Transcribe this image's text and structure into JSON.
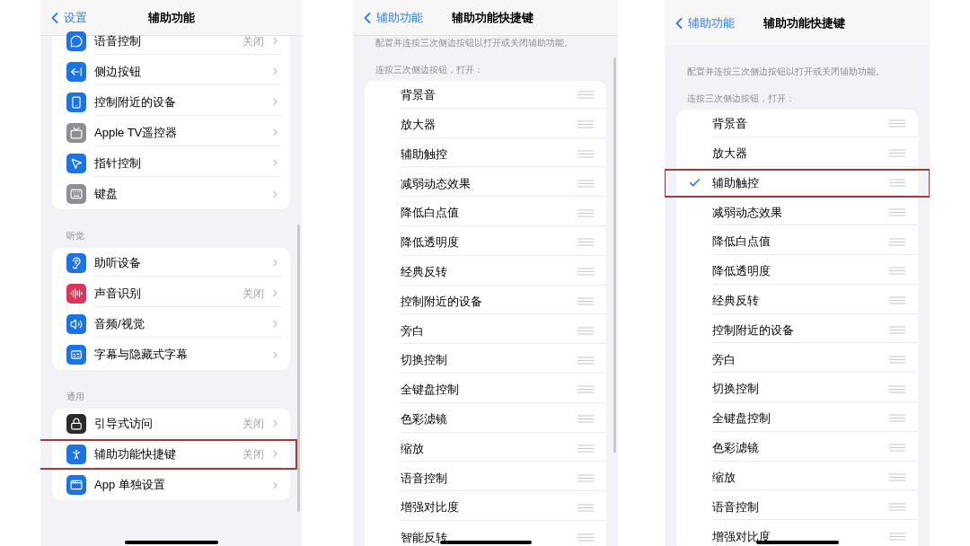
{
  "screens": [
    {
      "kind": "settings",
      "nav": {
        "back": "设置",
        "title": "辅助功能"
      },
      "sections": [
        {
          "rows": [
            {
              "label": "语音控制",
              "value": "关闭",
              "color": "#1a73e8",
              "highlighted": false
            },
            {
              "label": "侧边按钮",
              "color": "#1a73e8",
              "highlighted": false
            },
            {
              "label": "控制附近的设备",
              "color": "#1a73e8",
              "highlighted": false
            },
            {
              "label": "Apple TV遥控器",
              "color": "#8e8e93",
              "highlighted": false
            },
            {
              "label": "指针控制",
              "color": "#1a73e8",
              "highlighted": false
            },
            {
              "label": "键盘",
              "color": "#8e8e93",
              "highlighted": false
            }
          ]
        },
        {
          "header": "听觉",
          "rows": [
            {
              "label": "助听设备",
              "color": "#1a73e8",
              "highlighted": false
            },
            {
              "label": "声音识别",
              "value": "关闭",
              "color": "#e0325a",
              "highlighted": false
            },
            {
              "label": "音频/视觉",
              "color": "#1a73e8",
              "highlighted": false
            },
            {
              "label": "字幕与隐藏式字幕",
              "color": "#1a73e8",
              "highlighted": false
            }
          ]
        },
        {
          "header": "通用",
          "rows": [
            {
              "label": "引导式访问",
              "value": "关闭",
              "color": "#2c2c2e",
              "highlighted": false
            },
            {
              "label": "辅助功能快捷键",
              "value": "关闭",
              "color": "#1a73e8",
              "highlighted": true
            },
            {
              "label": "App 单独设置",
              "color": "#1a73e8",
              "highlighted": false
            }
          ]
        }
      ]
    },
    {
      "kind": "shortcut",
      "nav": {
        "back": "辅助功能",
        "title": "辅助功能快捷键"
      },
      "description": "配置并连按三次侧边按钮以打开或关闭辅助功能。",
      "subheader": "连按三次侧边按钮，打开：",
      "items": [
        {
          "label": "背景音",
          "checked": false,
          "highlighted": false
        },
        {
          "label": "放大器",
          "checked": false,
          "highlighted": false
        },
        {
          "label": "辅助触控",
          "checked": false,
          "highlighted": false
        },
        {
          "label": "减弱动态效果",
          "checked": false,
          "highlighted": false
        },
        {
          "label": "降低白点值",
          "checked": false,
          "highlighted": false
        },
        {
          "label": "降低透明度",
          "checked": false,
          "highlighted": false
        },
        {
          "label": "经典反转",
          "checked": false,
          "highlighted": false
        },
        {
          "label": "控制附近的设备",
          "checked": false,
          "highlighted": false
        },
        {
          "label": "旁白",
          "checked": false,
          "highlighted": false
        },
        {
          "label": "切换控制",
          "checked": false,
          "highlighted": false
        },
        {
          "label": "全键盘控制",
          "checked": false,
          "highlighted": false
        },
        {
          "label": "色彩滤镜",
          "checked": false,
          "highlighted": false
        },
        {
          "label": "缩放",
          "checked": false,
          "highlighted": false
        },
        {
          "label": "语音控制",
          "checked": false,
          "highlighted": false
        },
        {
          "label": "增强对比度",
          "checked": false,
          "highlighted": false
        },
        {
          "label": "智能反转",
          "checked": false,
          "highlighted": false
        }
      ]
    },
    {
      "kind": "shortcut",
      "nav": {
        "back": "辅助功能",
        "title": "辅助功能快捷键"
      },
      "description": "配置并连按三次侧边按钮以打开或关闭辅助功能。",
      "subheader": "连按三次侧边按钮，打开：",
      "items": [
        {
          "label": "背景音",
          "checked": false,
          "highlighted": false
        },
        {
          "label": "放大器",
          "checked": false,
          "highlighted": false
        },
        {
          "label": "辅助触控",
          "checked": true,
          "highlighted": true
        },
        {
          "label": "减弱动态效果",
          "checked": false,
          "highlighted": false
        },
        {
          "label": "降低白点值",
          "checked": false,
          "highlighted": false
        },
        {
          "label": "降低透明度",
          "checked": false,
          "highlighted": false
        },
        {
          "label": "经典反转",
          "checked": false,
          "highlighted": false
        },
        {
          "label": "控制附近的设备",
          "checked": false,
          "highlighted": false
        },
        {
          "label": "旁白",
          "checked": false,
          "highlighted": false
        },
        {
          "label": "切换控制",
          "checked": false,
          "highlighted": false
        },
        {
          "label": "全键盘控制",
          "checked": false,
          "highlighted": false
        },
        {
          "label": "色彩滤镜",
          "checked": false,
          "highlighted": false
        },
        {
          "label": "缩放",
          "checked": false,
          "highlighted": false
        },
        {
          "label": "语音控制",
          "checked": false,
          "highlighted": false
        },
        {
          "label": "增强对比度",
          "checked": false,
          "highlighted": false
        }
      ]
    }
  ]
}
